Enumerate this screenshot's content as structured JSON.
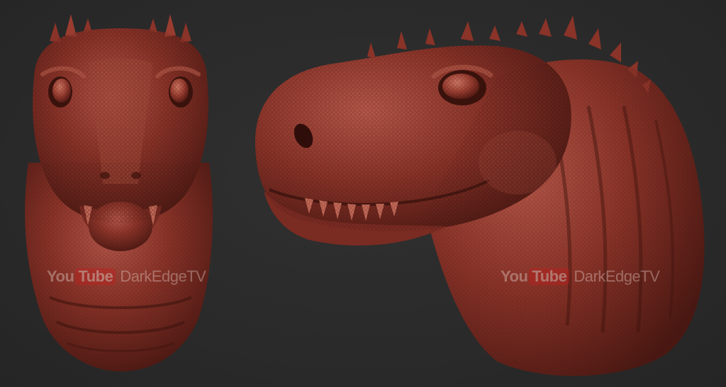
{
  "watermarks": [
    {
      "logo_left": "You",
      "logo_right": "Tube",
      "channel": "DarkEdgeTV"
    },
    {
      "logo_left": "You",
      "logo_right": "Tube",
      "channel": "DarkEdgeTV"
    }
  ],
  "colors": {
    "background": "#2a2a2a",
    "sculpt_base": "#8a3328",
    "sculpt_shadow": "#4a1812",
    "sculpt_highlight": "#c0604e",
    "logo_red": "#c61c1c"
  }
}
